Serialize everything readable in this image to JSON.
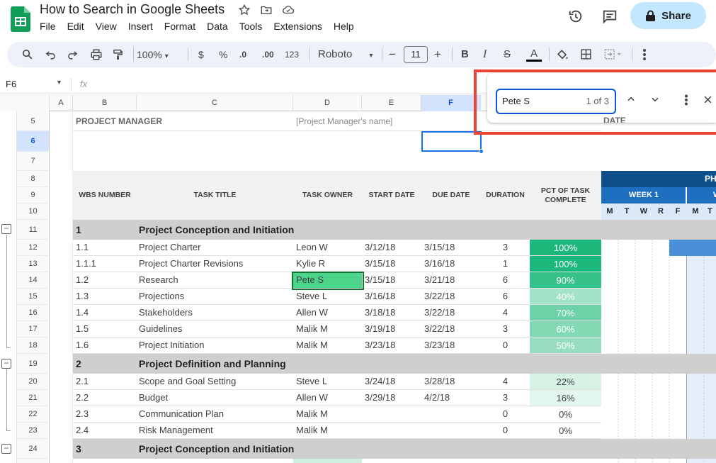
{
  "app": {
    "doc_title": "How to Search in Google Sheets",
    "menu": [
      "File",
      "Edit",
      "View",
      "Insert",
      "Format",
      "Data",
      "Tools",
      "Extensions",
      "Help"
    ],
    "share_label": "Share",
    "brand_color": "#0f9d58",
    "accent_color": "#c2e7ff"
  },
  "toolbar": {
    "zoom": "100%",
    "currency": "$",
    "percent": "%",
    "dec_decrease": ".0",
    "dec_increase": ".00",
    "number_format": "123",
    "font": "Roboto",
    "font_size": "11",
    "minus": "−",
    "plus": "+",
    "bold": "B",
    "italic": "I",
    "strike": "S",
    "text_color": "A"
  },
  "formula_bar": {
    "name_box": "F6",
    "fx": "fx"
  },
  "columns": [
    "A",
    "B",
    "C",
    "D",
    "E",
    "F"
  ],
  "selected_column": "F",
  "rows": [
    "5",
    "6",
    "7",
    "8",
    "9",
    "10",
    "11",
    "12",
    "13",
    "14",
    "15",
    "16",
    "17",
    "18",
    "19",
    "20",
    "21",
    "22",
    "23",
    "24"
  ],
  "selected_row": "6",
  "sheet": {
    "project_manager_label": "PROJECT MANAGER",
    "project_manager_name": "[Project Manager's name]",
    "date_label": "DATE",
    "headers": {
      "wbs": "WBS NUMBER",
      "title": "TASK TITLE",
      "owner": "TASK OWNER",
      "start": "START DATE",
      "due": "DUE DATE",
      "duration": "DURATION",
      "pct": "PCT OF TASK COMPLETE",
      "phase": "PH",
      "week1": "WEEK 1",
      "week2": "W",
      "days": [
        "M",
        "T",
        "W",
        "R",
        "F",
        "M",
        "T"
      ]
    },
    "sections": [
      {
        "num": "1",
        "title": "Project Conception and Initiation"
      },
      {
        "num": "2",
        "title": "Project Definition and Planning"
      },
      {
        "num": "3",
        "title": "Project Conception and Initiation"
      }
    ],
    "tasks": [
      {
        "wbs": "1.1",
        "title": "Project Charter",
        "owner": "Leon W",
        "start": "3/12/18",
        "due": "3/15/18",
        "duration": "3",
        "pct": "100%",
        "pct_color": "#1cb77a"
      },
      {
        "wbs": "1.1.1",
        "title": "Project Charter Revisions",
        "owner": "Kylie R",
        "start": "3/15/18",
        "due": "3/16/18",
        "duration": "1",
        "pct": "100%",
        "pct_color": "#1cb77a"
      },
      {
        "wbs": "1.2",
        "title": "Research",
        "owner": "Pete S",
        "start": "3/15/18",
        "due": "3/21/18",
        "duration": "6",
        "pct": "90%",
        "pct_color": "#37c18a"
      },
      {
        "wbs": "1.3",
        "title": "Projections",
        "owner": "Steve L",
        "start": "3/16/18",
        "due": "3/22/18",
        "duration": "6",
        "pct": "40%",
        "pct_color": "#a3e3c8"
      },
      {
        "wbs": "1.4",
        "title": "Stakeholders",
        "owner": "Allen W",
        "start": "3/18/18",
        "due": "3/22/18",
        "duration": "4",
        "pct": "70%",
        "pct_color": "#6dd2a8"
      },
      {
        "wbs": "1.5",
        "title": "Guidelines",
        "owner": "Malik M",
        "start": "3/19/18",
        "due": "3/22/18",
        "duration": "3",
        "pct": "60%",
        "pct_color": "#84d9b5"
      },
      {
        "wbs": "1.6",
        "title": "Project Initiation",
        "owner": "Malik M",
        "start": "3/23/18",
        "due": "3/23/18",
        "duration": "0",
        "pct": "50%",
        "pct_color": "#97dec0"
      },
      {
        "wbs": "2.1",
        "title": "Scope and Goal Setting",
        "owner": "Steve L",
        "start": "3/24/18",
        "due": "3/28/18",
        "duration": "4",
        "pct": "22%",
        "pct_color": "#d7f3e6"
      },
      {
        "wbs": "2.2",
        "title": "Budget",
        "owner": "Allen W",
        "start": "3/29/18",
        "due": "4/2/18",
        "duration": "3",
        "pct": "16%",
        "pct_color": "#e2f6ed"
      },
      {
        "wbs": "2.3",
        "title": "Communication Plan",
        "owner": "Malik M",
        "start": "",
        "due": "",
        "duration": "0",
        "pct": "0%",
        "pct_color": "#ffffff"
      },
      {
        "wbs": "2.4",
        "title": "Risk Management",
        "owner": "Malik M",
        "start": "",
        "due": "",
        "duration": "0",
        "pct": "0%",
        "pct_color": "#ffffff"
      }
    ]
  },
  "find": {
    "query": "Pete S",
    "count": "1 of 3"
  }
}
